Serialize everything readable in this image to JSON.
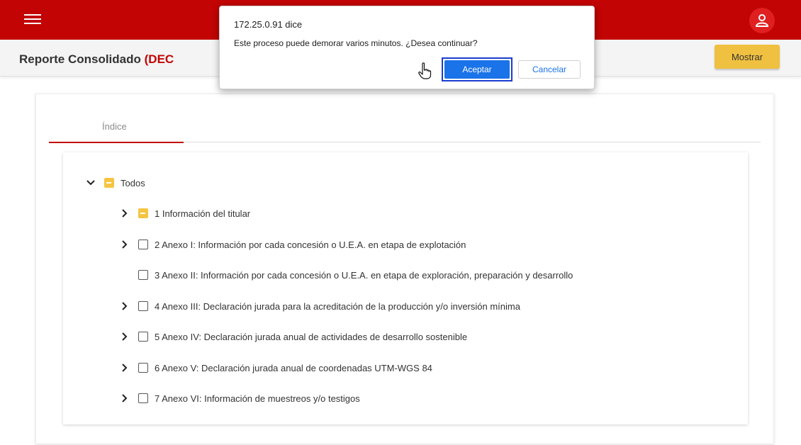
{
  "header": {
    "menu_icon": "hamburger-menu-icon",
    "user_icon": "user-account-icon",
    "brand_color": "#c20404"
  },
  "subheader": {
    "title": "Reporte Consolidado",
    "title_accent": "(DEC",
    "show_button": "Mostrar"
  },
  "tabs": [
    {
      "label": "Índice",
      "active": true
    }
  ],
  "tree": {
    "root": {
      "label": "Todos",
      "state": "partial",
      "expanded": true
    },
    "items": [
      {
        "label": "1 Información del titular",
        "state": "partial",
        "expandable": true
      },
      {
        "label": "2 Anexo I: Información por cada concesión o U.E.A. en etapa de explotación",
        "state": "unchecked",
        "expandable": true
      },
      {
        "label": "3 Anexo II: Información por cada concesión o U.E.A. en etapa de exploración, preparación y desarrollo",
        "state": "unchecked",
        "expandable": false
      },
      {
        "label": "4 Anexo III: Declaración jurada para la acreditación de la producción y/o inversión mínima",
        "state": "unchecked",
        "expandable": true
      },
      {
        "label": "5 Anexo IV: Declaración jurada anual de actividades de desarrollo sostenible",
        "state": "unchecked",
        "expandable": true
      },
      {
        "label": "6 Anexo V: Declaración jurada anual de coordenadas UTM-WGS 84",
        "state": "unchecked",
        "expandable": true
      },
      {
        "label": "7 Anexo VI: Información de muestreos y/o testigos",
        "state": "unchecked",
        "expandable": true
      }
    ]
  },
  "dialog": {
    "title": "172.25.0.91 dice",
    "message": "Este proceso puede demorar varios minutos. ¿Desea continuar?",
    "ok_label": "Aceptar",
    "cancel_label": "Cancelar",
    "ok_color": "#1a73e8"
  }
}
